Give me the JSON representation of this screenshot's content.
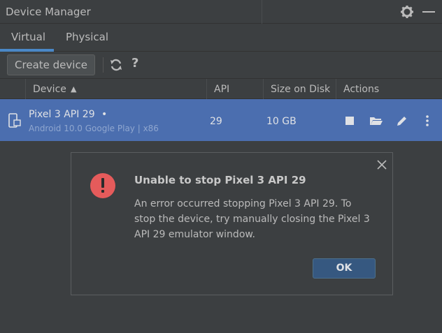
{
  "window": {
    "title": "Device Manager",
    "settings_icon": "gear-icon",
    "minimize_icon": "minimize-icon"
  },
  "tabs": [
    {
      "label": "Virtual",
      "selected": true
    },
    {
      "label": "Physical",
      "selected": false
    }
  ],
  "toolbar": {
    "create_label": "Create device",
    "refresh_icon": "refresh-icon",
    "help_label": "?"
  },
  "table": {
    "headers": {
      "device": "Device",
      "sort_indicator": "▲",
      "api": "API",
      "size": "Size on Disk",
      "actions": "Actions"
    },
    "rows": [
      {
        "name": "Pixel 3 API 29",
        "status_dot": "•",
        "subtitle": "Android 10.0 Google Play | x86",
        "api": "29",
        "size": "10 GB",
        "selected": true
      }
    ]
  },
  "dialog": {
    "title": "Unable to stop Pixel 3 API 29",
    "message": "An error occurred stopping Pixel 3 API 29. To stop the device, try manually closing the Pixel 3 API 29 emulator window.",
    "ok_label": "OK",
    "icon": "error-icon"
  },
  "colors": {
    "accent": "#4a88c7",
    "selection": "#4b6eaf",
    "error": "#e55b5b",
    "ok_button": "#365880"
  }
}
